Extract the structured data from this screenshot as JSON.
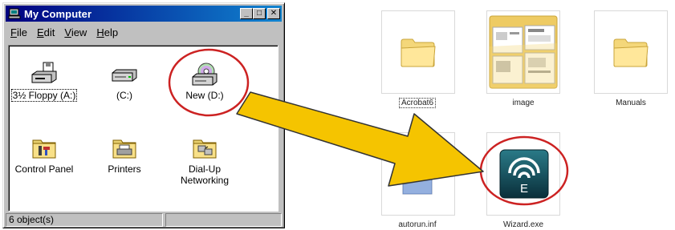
{
  "window": {
    "title": "My Computer",
    "controls": {
      "minimize": "_",
      "maximize": "□",
      "close": "✕"
    },
    "menu": [
      {
        "key": "F",
        "rest": "ile"
      },
      {
        "key": "E",
        "rest": "dit"
      },
      {
        "key": "V",
        "rest": "iew"
      },
      {
        "key": "H",
        "rest": "elp"
      }
    ],
    "items": [
      {
        "label": "3½ Floppy (A:)",
        "icon": "floppy-drive-icon"
      },
      {
        "label": "(C:)",
        "icon": "hard-drive-icon"
      },
      {
        "label": "New (D:)",
        "icon": "cd-drive-icon"
      },
      {
        "label": "Control Panel",
        "icon": "control-panel-folder-icon"
      },
      {
        "label": "Printers",
        "icon": "printers-folder-icon"
      },
      {
        "label": "Dial-Up Networking",
        "icon": "dialup-networking-folder-icon"
      }
    ],
    "status": "6 object(s)"
  },
  "files": [
    {
      "label": "Acrobat6",
      "icon": "folder-icon"
    },
    {
      "label": "image",
      "icon": "image-folder-icon"
    },
    {
      "label": "Manuals",
      "icon": "folder-icon"
    },
    {
      "label": "autorun.inf",
      "icon": "text-file-icon"
    },
    {
      "label": "Wizard.exe",
      "icon": "wizard-app-icon"
    }
  ],
  "annotation": {
    "highlight_color": "#cc2222",
    "arrow_color": "#f5c400"
  }
}
